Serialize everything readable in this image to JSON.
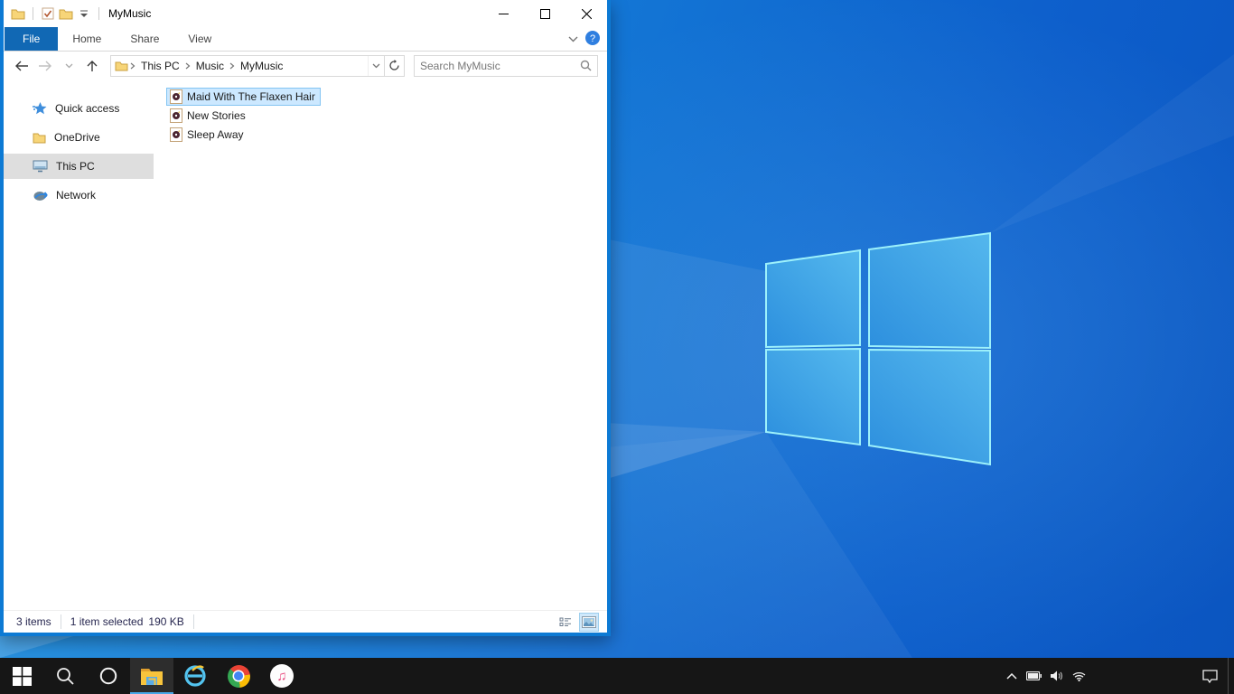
{
  "window": {
    "title": "MyMusic",
    "qat_icons": [
      "folder-icon",
      "properties-check-icon",
      "new-folder-icon",
      "qat-dropdown-icon"
    ],
    "controls": [
      "minimize",
      "maximize",
      "close"
    ]
  },
  "ribbon": {
    "tabs": [
      {
        "label": "File",
        "active": true
      },
      {
        "label": "Home",
        "active": false
      },
      {
        "label": "Share",
        "active": false
      },
      {
        "label": "View",
        "active": false
      }
    ],
    "right_icons": [
      "collapse-ribbon-chevron-icon",
      "help-icon"
    ]
  },
  "navbar": {
    "nav_icons": [
      "back-icon",
      "forward-icon",
      "recent-chevron-icon",
      "up-icon"
    ],
    "breadcrumb": [
      "This PC",
      "Music",
      "MyMusic"
    ],
    "address_icons": [
      "folder-icon",
      "address-dropdown-chevron-icon",
      "refresh-icon"
    ],
    "search_placeholder": "Search MyMusic",
    "search_icon": "magnifier-icon"
  },
  "sidebar": {
    "items": [
      {
        "label": "Quick access",
        "icon": "quick-access-star-icon",
        "selected": false
      },
      {
        "label": "OneDrive",
        "icon": "onedrive-folder-icon",
        "selected": false
      },
      {
        "label": "This PC",
        "icon": "monitor-icon",
        "selected": true
      },
      {
        "label": "Network",
        "icon": "network-icon",
        "selected": false
      }
    ]
  },
  "files": {
    "items": [
      {
        "name": "Maid With The Flaxen Hair",
        "icon": "audio-file-icon",
        "selected": true
      },
      {
        "name": "New Stories",
        "icon": "audio-file-icon",
        "selected": false
      },
      {
        "name": "Sleep Away",
        "icon": "audio-file-icon",
        "selected": false
      }
    ]
  },
  "statusbar": {
    "item_count": "3 items",
    "selection": "1 item selected",
    "selection_size": "190 KB",
    "view_icons": [
      "details-view-icon",
      "thumbnail-view-icon"
    ]
  },
  "taskbar": {
    "buttons": [
      "start",
      "search",
      "cortana",
      "file-explorer",
      "internet-explorer",
      "chrome",
      "itunes"
    ],
    "active_button": "file-explorer",
    "tray_icons": [
      "tray-expand-chevron",
      "battery",
      "volume",
      "wifi",
      "action-center",
      "show-desktop"
    ]
  },
  "colors": {
    "accent_border": "#0d7ad4",
    "file_tab": "#1168b4",
    "selection_fill": "#cce8ff",
    "selection_border": "#84c5f2",
    "sidebar_selected": "#dedede",
    "taskbar_bg": "#161616",
    "taskbar_underline": "#47a8e8",
    "wallpaper_base": "#0d5ecb",
    "wallpaper_logo_stroke": "#9df1fb"
  }
}
